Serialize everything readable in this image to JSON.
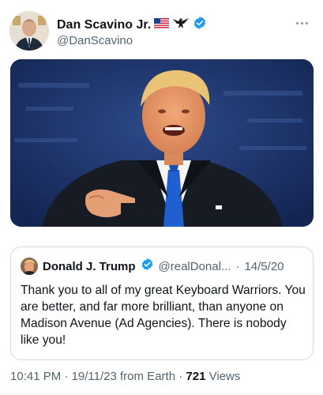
{
  "tweet": {
    "author": {
      "display_name": "Dan Scavino Jr.",
      "flag_icon": "us-flag-icon",
      "eagle_icon": "eagle-icon",
      "verified_icon": "verified-badge-icon",
      "handle": "@DanScavino"
    },
    "more_icon": "more-dots-icon",
    "media": {
      "type": "photo"
    },
    "quote": {
      "author_name": "Donald J. Trump",
      "verified_icon": "verified-badge-icon",
      "handle": "@realDonal...",
      "separator": "·",
      "date": "14/5/20",
      "text": "Thank you to all of my great Keyboard Warriors. You are better, and far more brilliant, than anyone on Madison Avenue (Ad Agencies). There is nobody like you!"
    },
    "meta": {
      "time": "10:41 PM",
      "sep1": "·",
      "date": "19/11/23",
      "source": "from Earth",
      "sep2": "·",
      "views_count": "721",
      "views_label": "Views"
    }
  },
  "colors": {
    "verified": "#1d9bf0",
    "secondary_text": "#536471",
    "primary_text": "#0f1419",
    "border": "#cfd9de"
  }
}
